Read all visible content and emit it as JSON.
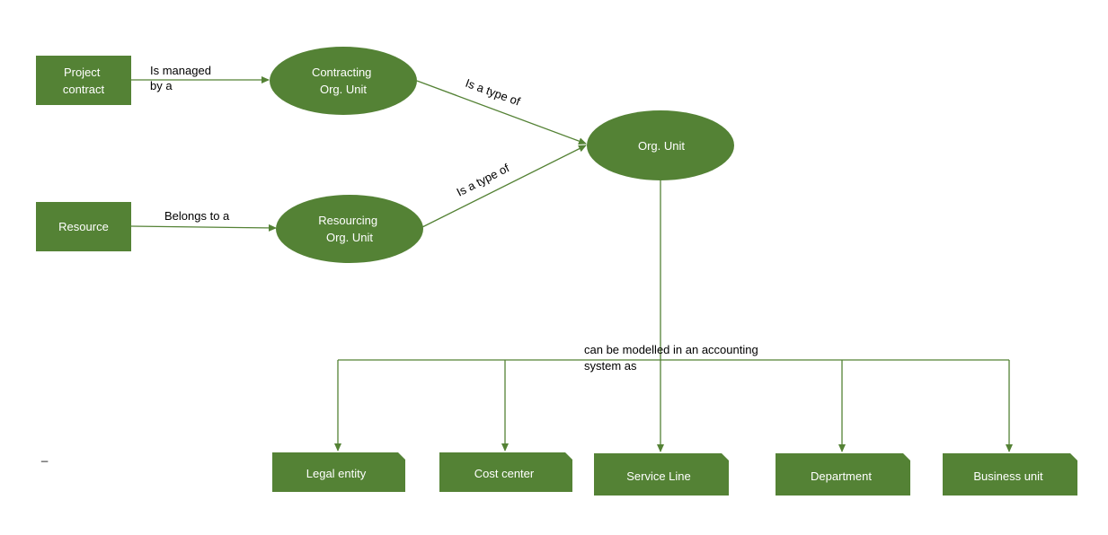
{
  "diagram": {
    "colors": {
      "node_fill": "#548235",
      "edge": "#548235",
      "node_text": "#ffffff",
      "label_text": "#000000"
    },
    "nodes": {
      "project_contract": {
        "lines": [
          "Project",
          "contract"
        ],
        "shape": "rectangle"
      },
      "resource": {
        "lines": [
          "Resource"
        ],
        "shape": "rectangle"
      },
      "contracting_org_unit": {
        "lines": [
          "Contracting",
          "Org. Unit"
        ],
        "shape": "ellipse"
      },
      "resourcing_org_unit": {
        "lines": [
          "Resourcing",
          "Org. Unit"
        ],
        "shape": "ellipse"
      },
      "org_unit": {
        "lines": [
          "Org. Unit"
        ],
        "shape": "ellipse"
      },
      "legal_entity": {
        "lines": [
          "Legal entity"
        ],
        "shape": "snipped-rectangle"
      },
      "cost_center": {
        "lines": [
          "Cost center"
        ],
        "shape": "snipped-rectangle"
      },
      "service_line": {
        "lines": [
          "Service Line"
        ],
        "shape": "snipped-rectangle"
      },
      "department": {
        "lines": [
          "Department"
        ],
        "shape": "snipped-rectangle"
      },
      "business_unit": {
        "lines": [
          "Business unit"
        ],
        "shape": "snipped-rectangle"
      }
    },
    "edges": {
      "managed_by": {
        "from": "project_contract",
        "to": "contracting_org_unit",
        "lines": [
          "Is managed",
          "by a"
        ]
      },
      "belongs_to": {
        "from": "resource",
        "to": "resourcing_org_unit",
        "lines": [
          "Belongs to a"
        ]
      },
      "contracting_type_of": {
        "from": "contracting_org_unit",
        "to": "org_unit",
        "lines": [
          "Is a type of"
        ]
      },
      "resourcing_type_of": {
        "from": "resourcing_org_unit",
        "to": "org_unit",
        "lines": [
          "Is a type of"
        ]
      },
      "modelled_as": {
        "from": "org_unit",
        "to": [
          "legal_entity",
          "cost_center",
          "service_line",
          "department",
          "business_unit"
        ],
        "lines": [
          "can be modelled in an accounting",
          "system as"
        ]
      }
    },
    "stray_mark": "_"
  }
}
